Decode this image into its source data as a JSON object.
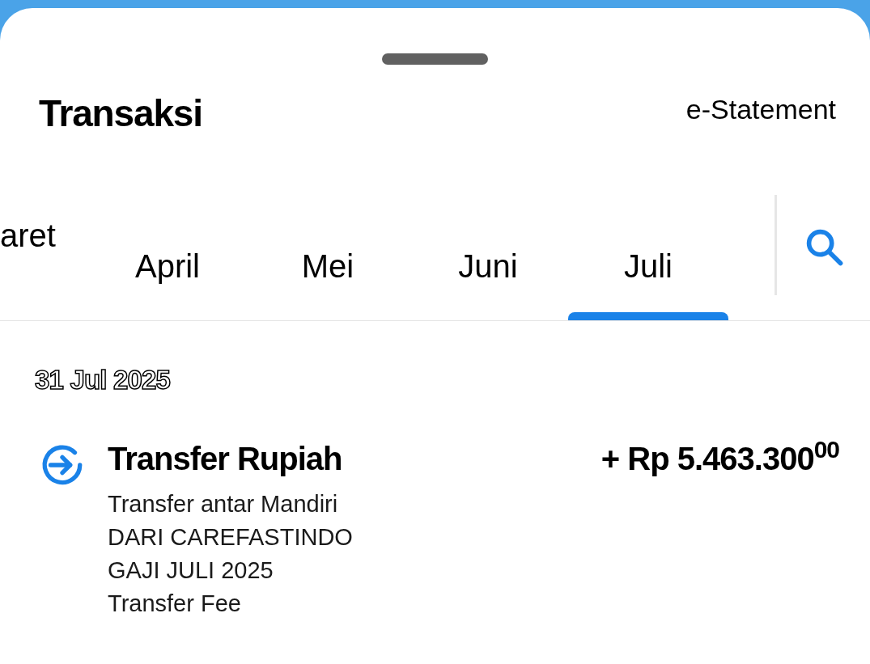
{
  "header": {
    "title": "Transaksi",
    "action": "e-Statement"
  },
  "tabs": [
    {
      "label": "aret",
      "selected": false
    },
    {
      "label": "April",
      "selected": false
    },
    {
      "label": "Mei",
      "selected": false
    },
    {
      "label": "Juni",
      "selected": false
    },
    {
      "label": "Juli",
      "selected": true
    }
  ],
  "groups": [
    {
      "date": "31 Jul 2025",
      "transactions": [
        {
          "title": "Transfer Rupiah",
          "amount": "+ Rp 5.463.300$^{00}$",
          "details": [
            "Transfer antar Mandiri",
            "DARI CAREFASTINDO",
            "GAJI JULI 2025",
            "Transfer Fee"
          ]
        }
      ]
    }
  ]
}
